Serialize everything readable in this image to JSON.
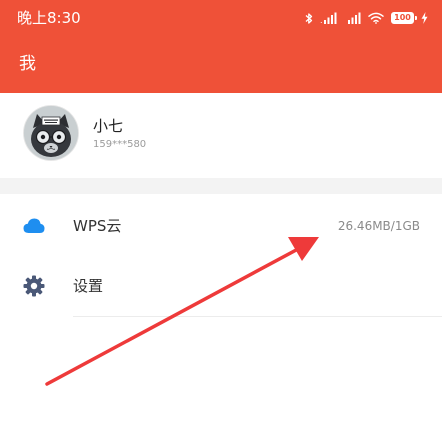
{
  "status_bar": {
    "time": "晚上8:30",
    "battery_level": "100",
    "icons": [
      "bluetooth-icon",
      "signal-icon",
      "signal-icon",
      "wifi-icon",
      "battery-icon",
      "charging-icon"
    ]
  },
  "header": {
    "title": "我"
  },
  "profile": {
    "name": "小七",
    "phone": "159***580",
    "avatar_icon": "avatar-cat-icon"
  },
  "menu": {
    "items": [
      {
        "label": "WPS云",
        "value": "26.46MB/1GB",
        "icon": "cloud-icon"
      },
      {
        "label": "设置",
        "icon": "gear-icon"
      }
    ]
  },
  "colors": {
    "header_background": "#ef5138",
    "cloud_icon": "#1e8ef0",
    "gear_icon": "#4a5877",
    "annotation_arrow": "#ee3a3a"
  }
}
